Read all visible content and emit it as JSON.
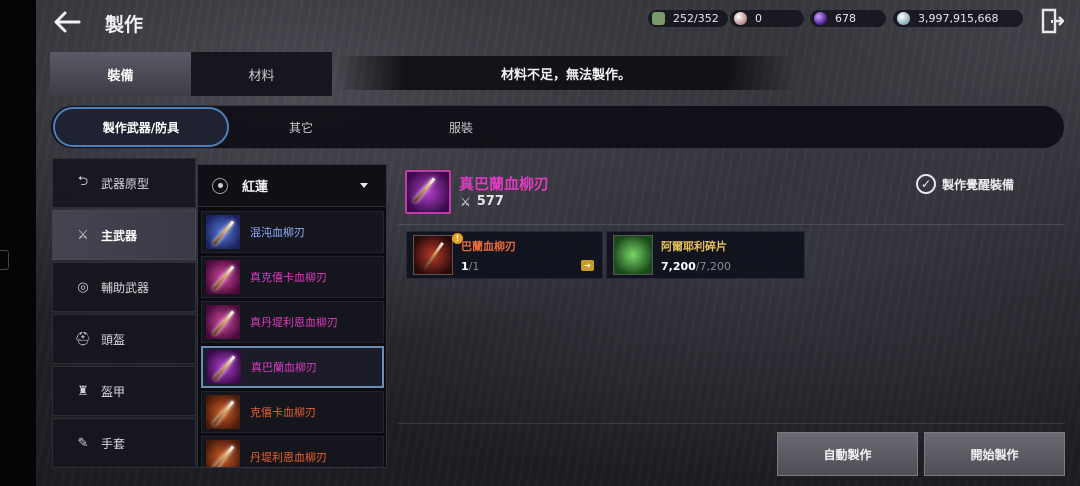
{
  "header": {
    "title": "製作",
    "resources": [
      {
        "icon": "inventory-icon",
        "value": "252/352"
      },
      {
        "icon": "pearl-icon",
        "value": "0"
      },
      {
        "icon": "purple-crystal-icon",
        "value": "678"
      },
      {
        "icon": "silver-icon",
        "value": "3,997,915,668"
      }
    ]
  },
  "tabs": {
    "equipment": "裝備",
    "material": "材料"
  },
  "notice": "材料不足，無法製作。",
  "subtabs": {
    "weapon_armor": "製作武器/防具",
    "other": "其它",
    "costume": "服裝"
  },
  "categories": [
    {
      "icon": "prototype-icon",
      "label": "武器原型"
    },
    {
      "icon": "main-weapon-icon",
      "label": "主武器"
    },
    {
      "icon": "sub-weapon-icon",
      "label": "輔助武器"
    },
    {
      "icon": "helmet-icon",
      "label": "頭盔"
    },
    {
      "icon": "armor-icon",
      "label": "盔甲"
    },
    {
      "icon": "gloves-icon",
      "label": "手套"
    }
  ],
  "dropdown": {
    "selected": "紅蓮",
    "items": [
      {
        "name": "混沌血柳刃",
        "color": "#8fb0ff"
      },
      {
        "name": "真克僖卡血柳刃",
        "color": "#e03ac0"
      },
      {
        "name": "真丹堤利恩血柳刃",
        "color": "#e03ac0"
      },
      {
        "name": "真巴蘭血柳刃",
        "color": "#e03ac0"
      },
      {
        "name": "克僖卡血柳刃",
        "color": "#e8602a"
      },
      {
        "name": "丹堤利恩血柳刃",
        "color": "#e8602a"
      }
    ]
  },
  "detail": {
    "name": "真巴蘭血柳刃",
    "power": "577",
    "awaken_label": "製作覺醒裝備"
  },
  "materials": [
    {
      "name": "巴蘭血柳刃",
      "have": "1",
      "need": "/1"
    },
    {
      "name": "阿爾耶利碎片",
      "have": "7,200",
      "need": "/7,200"
    }
  ],
  "buttons": {
    "auto": "自動製作",
    "start": "開始製作"
  }
}
